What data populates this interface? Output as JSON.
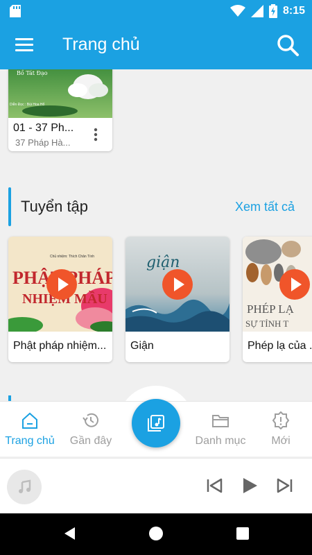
{
  "status_bar": {
    "time": "8:15",
    "battery_icon": "battery-charging-icon",
    "wifi_icon": "wifi-icon",
    "signal_icon": "signal-icon",
    "sd_icon": "sd-card-icon"
  },
  "app_bar": {
    "title": "Trang chủ",
    "menu_icon": "hamburger-menu-icon",
    "search_icon": "search-icon"
  },
  "recent_card": {
    "title": "01 - 37 Ph...",
    "subtitle": "37 Pháp Hà...",
    "thumb_title": "Bồ Tát Đạo",
    "thumb_caption": "Diễn Đọc : Bùi Hoa Hổ"
  },
  "section": {
    "title": "Tuyển tập",
    "see_all": "Xem tất cả"
  },
  "albums": [
    {
      "title": "Phật pháp nhiệm...",
      "cover_top": "Chủ nhiệm: Thích Chân Tính",
      "cover_text_1": "PHẬT PHÁP",
      "cover_text_2": "NHIỆM MẦU"
    },
    {
      "title": "Giận",
      "cover_text_1": "giận"
    },
    {
      "title": "Phép lạ của ...",
      "cover_text_1": "PHÉP LẠ",
      "cover_text_2": "SỰ TỈNH T"
    }
  ],
  "bottom_nav": [
    {
      "label": "Trang chủ",
      "icon": "home-icon",
      "active": true
    },
    {
      "label": "Gần đây",
      "icon": "history-icon",
      "active": false
    },
    {
      "label": "Danh mục",
      "icon": "folder-icon",
      "active": false
    },
    {
      "label": "Mới",
      "icon": "new-badge-icon",
      "active": false
    }
  ],
  "center_button_icon": "music-library-icon",
  "player": {
    "art_icon": "music-note-icon",
    "prev_icon": "skip-previous-icon",
    "play_icon": "play-icon",
    "next_icon": "skip-next-icon"
  },
  "colors": {
    "primary": "#1ba1e2",
    "play_button": "#f0552a"
  }
}
